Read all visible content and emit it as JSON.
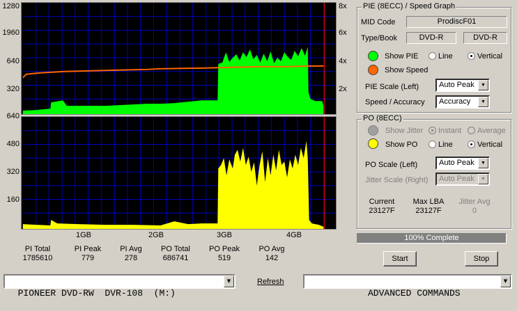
{
  "pie_chart": {
    "y_left_ticks": [
      "1280",
      "1960",
      "640",
      "320",
      "640"
    ],
    "y_right_ticks": [
      "8x",
      "6x",
      "4x",
      "2x"
    ],
    "pie_color": "#00ff00",
    "speed_color": "#ff6600",
    "grid_color": "#0000c0"
  },
  "po_chart": {
    "y_left_ticks": [
      "480",
      "320",
      "160"
    ],
    "x_ticks": [
      "1GB",
      "2GB",
      "3GB",
      "4GB"
    ],
    "po_color": "#ffff00"
  },
  "stats": [
    {
      "label": "PI Total",
      "value": "1785610"
    },
    {
      "label": "PI Peak",
      "value": "779"
    },
    {
      "label": "PI Avg",
      "value": "278"
    },
    {
      "label": "PO Total",
      "value": "686741"
    },
    {
      "label": "PO Peak",
      "value": "519"
    },
    {
      "label": "PO Avg",
      "value": "142"
    }
  ],
  "pie_group": {
    "title": "PIE (8ECC) / Speed Graph",
    "mid_label": "MID Code",
    "mid_value": "ProdiscF01",
    "type_label": "Type/Book",
    "type_value": "DVD-R",
    "book_value": "DVD-R",
    "show_pie": "Show PIE",
    "line": "Line",
    "vertical": "Vertical",
    "show_speed": "Show Speed",
    "scale_label": "PIE Scale (Left)",
    "scale_value": "Auto Peak",
    "speed_label": "Speed / Accuracy",
    "speed_value": "Accuracy"
  },
  "po_group": {
    "title": "PO (8ECC)",
    "show_jitter": "Show Jitter",
    "instant": "Instant",
    "average": "Average",
    "show_po": "Show PO",
    "line": "Line",
    "vertical": "Vertical",
    "scale_label": "PO Scale (Left)",
    "scale_value": "Auto Peak",
    "jitter_scale_label": "Jitter Scale (Right)",
    "jitter_scale_value": "Auto Peak",
    "current_label": "Current",
    "current_value": "23127F",
    "maxlba_label": "Max LBA",
    "maxlba_value": "23127F",
    "jitter_avg_label": "Jitter Avg",
    "jitter_avg_value": "0"
  },
  "progress": {
    "text": "100% Complete",
    "fraction": 1.0
  },
  "buttons": {
    "start": "Start",
    "stop": "Stop",
    "refresh": "Refresh"
  },
  "drive": {
    "value": "PIONEER DVD-RW  DVR-108  (M:)"
  },
  "commands": {
    "value": "ADVANCED COMMANDS"
  }
}
